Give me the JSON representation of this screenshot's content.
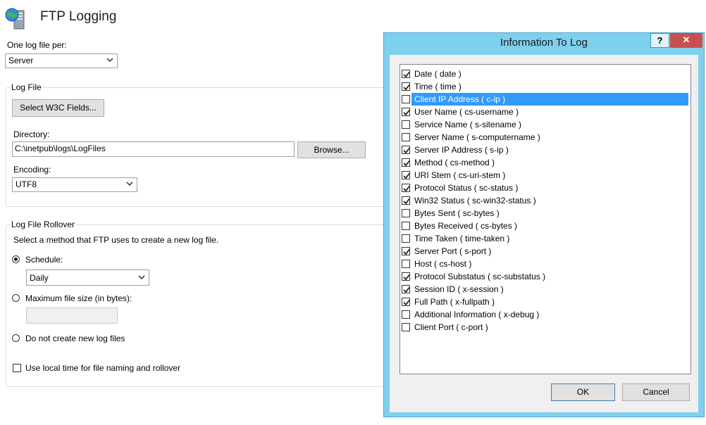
{
  "header": {
    "title": "FTP Logging"
  },
  "log_file_per": {
    "label": "One log file per:",
    "value": "Server"
  },
  "log_file": {
    "group_label": "Log File",
    "select_fields_button": "Select W3C Fields...",
    "directory_label": "Directory:",
    "directory_value": "C:\\inetpub\\logs\\LogFiles",
    "browse_button": "Browse...",
    "encoding_label": "Encoding:",
    "encoding_value": "UTF8"
  },
  "rollover": {
    "group_label": "Log File Rollover",
    "description": "Select a method that FTP uses to create a new log file.",
    "schedule_label": "Schedule:",
    "schedule_value": "Daily",
    "max_size_label": "Maximum file size (in bytes):",
    "max_size_value": "",
    "no_new_label": "Do not create new log files",
    "local_time_label": "Use local time for file naming and rollover"
  },
  "dialog": {
    "title": "Information To Log",
    "help": "?",
    "close": "✕",
    "ok": "OK",
    "cancel": "Cancel",
    "fields": [
      {
        "label": "Date ( date )",
        "checked": true
      },
      {
        "label": "Time ( time )",
        "checked": true
      },
      {
        "label": "Client IP Address ( c-ip )",
        "checked": false,
        "selected": true
      },
      {
        "label": "User Name ( cs-username )",
        "checked": true
      },
      {
        "label": "Service Name ( s-sitename )",
        "checked": false
      },
      {
        "label": "Server Name ( s-computername )",
        "checked": false
      },
      {
        "label": "Server IP Address ( s-ip )",
        "checked": true
      },
      {
        "label": "Method ( cs-method )",
        "checked": true
      },
      {
        "label": "URI Stem ( cs-uri-stem )",
        "checked": true
      },
      {
        "label": "Protocol Status ( sc-status )",
        "checked": true
      },
      {
        "label": "Win32 Status ( sc-win32-status )",
        "checked": true
      },
      {
        "label": "Bytes Sent ( sc-bytes )",
        "checked": false
      },
      {
        "label": "Bytes Received ( cs-bytes )",
        "checked": false
      },
      {
        "label": "Time Taken ( time-taken )",
        "checked": false
      },
      {
        "label": "Server Port ( s-port )",
        "checked": true
      },
      {
        "label": "Host ( cs-host )",
        "checked": false
      },
      {
        "label": "Protocol Substatus ( sc-substatus )",
        "checked": true
      },
      {
        "label": "Session ID ( x-session )",
        "checked": true
      },
      {
        "label": "Full Path ( x-fullpath )",
        "checked": true
      },
      {
        "label": "Additional Information ( x-debug )",
        "checked": false
      },
      {
        "label": "Client Port ( c-port )",
        "checked": false
      }
    ]
  },
  "colors": {
    "selection": "#3399ff",
    "dialog_frame": "#7fd0ee",
    "close_button": "#c75050"
  }
}
